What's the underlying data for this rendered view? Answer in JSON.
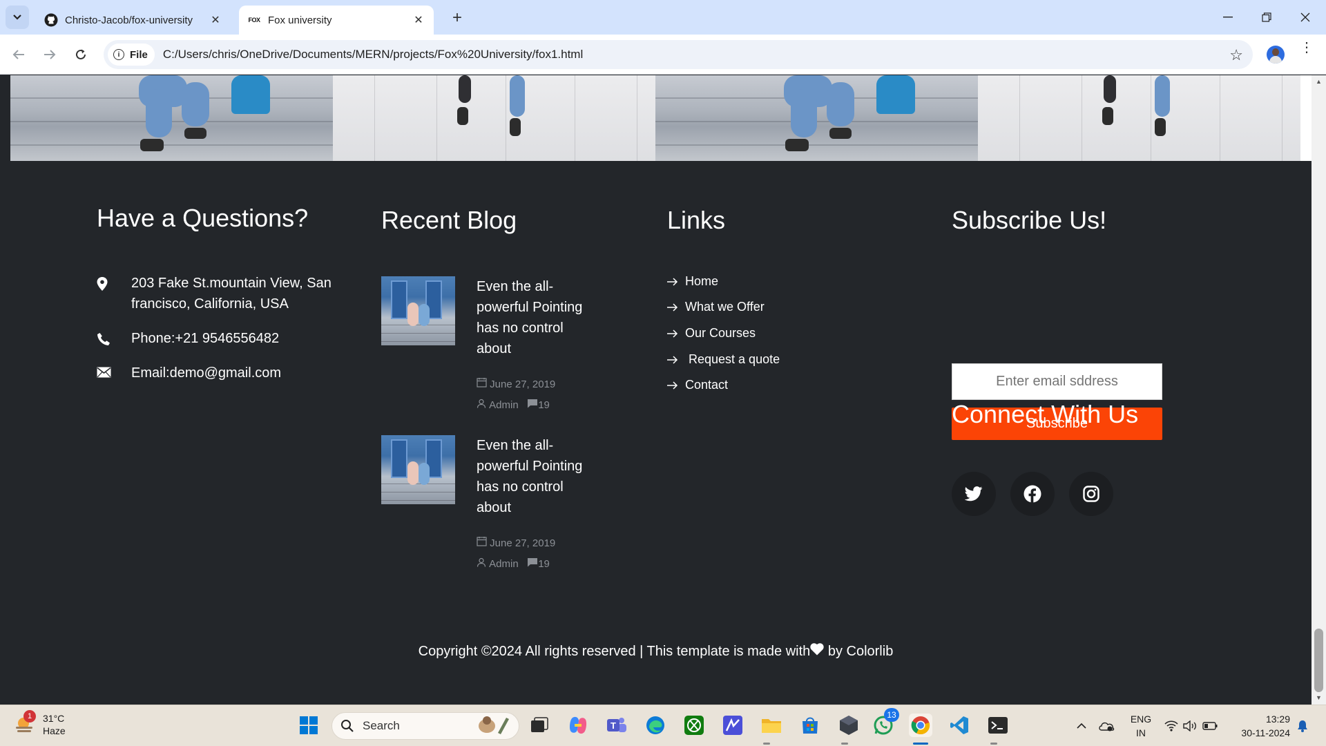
{
  "browser": {
    "tabs": [
      {
        "title": "Christo-Jacob/fox-university",
        "icon": "github-icon",
        "active": false
      },
      {
        "title": "Fox university",
        "icon": "fox-favicon-icon",
        "active": true
      }
    ],
    "favicon_text": "FOX",
    "address_chip": "File",
    "url": "C:/Users/chris/OneDrive/Documents/MERN/projects/Fox%20University/fox1.html"
  },
  "footer": {
    "contact": {
      "title": "Have a Questions?",
      "address": "203 Fake St.mountain View, San francisco, California, USA",
      "phone": "Phone:+21 9546556482",
      "email": "Email:demo@gmail.com"
    },
    "blog": {
      "title": "Recent Blog",
      "posts": [
        {
          "title": "Even the all-powerful Pointing has no control about",
          "date": "June 27, 2019",
          "author": "Admin",
          "comments": "19"
        },
        {
          "title": "Even the all-powerful Pointing has no control about",
          "date": "June 27, 2019",
          "author": "Admin",
          "comments": "19"
        }
      ]
    },
    "links": {
      "title": "Links",
      "items": [
        "Home",
        "What we Offer",
        "Our Courses",
        " Request a quote",
        "Contact"
      ]
    },
    "subscribe": {
      "title": "Subscribe Us!",
      "placeholder": "Enter email sddress",
      "button": "Subscribe"
    },
    "connect": {
      "title": "Connect With Us",
      "socials": [
        "twitter-icon",
        "facebook-icon",
        "instagram-icon"
      ]
    },
    "copyright_before": "Copyright ©2024 All rights reserved | This template is made with",
    "copyright_after": " by Colorlib"
  },
  "taskbar": {
    "weather_temp": "31°C",
    "weather_desc": "Haze",
    "weather_badge": "1",
    "search_label": "Search",
    "whatsapp_badge": "13",
    "lang_line1": "ENG",
    "lang_line2": "IN",
    "time": "13:29",
    "date": "30-11-2024"
  },
  "colors": {
    "accent": "#fb4406",
    "footer_bg": "#23262a",
    "tabbar_bg": "#d3e3fd"
  }
}
